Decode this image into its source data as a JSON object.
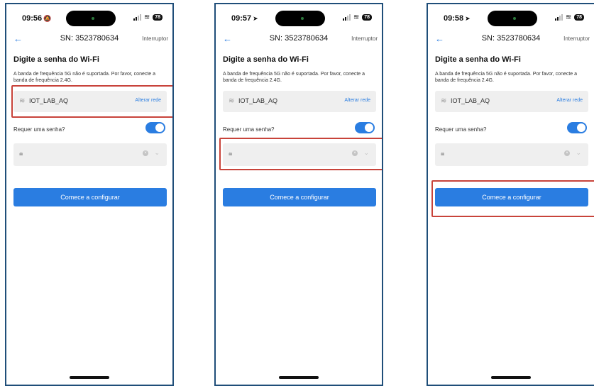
{
  "screens": [
    {
      "time": "09:56",
      "time_glyph": "🔕",
      "battery": "78",
      "serial": "SN: 3523780634",
      "nav_right": "Interruptor",
      "heading": "Digite a senha do Wi-Fi",
      "subtext": "A banda de frequência 5G não é suportada. Por favor, conecte a banda de frequência 2.4G.",
      "ssid": "IOT_LAB_AQ",
      "change_network": "Alterar rede",
      "password_required_label": "Requer uma senha?",
      "password_value": "",
      "start_button": "Comece a configurar",
      "highlighted": "network-row"
    },
    {
      "time": "09:57",
      "time_glyph": "➤",
      "battery": "78",
      "serial": "SN: 3523780634",
      "nav_right": "Interruptor",
      "heading": "Digite a senha do Wi-Fi",
      "subtext": "A banda de frequência 5G não é suportada. Por favor, conecte a banda de frequência 2.4G.",
      "ssid": "IOT_LAB_AQ",
      "change_network": "Alterar rede",
      "password_required_label": "Requer uma senha?",
      "password_value": "",
      "start_button": "Comece a configurar",
      "highlighted": "password-field"
    },
    {
      "time": "09:58",
      "time_glyph": "➤",
      "battery": "78",
      "serial": "SN: 3523780634",
      "nav_right": "Interruptor",
      "heading": "Digite a senha do Wi-Fi",
      "subtext": "A banda de frequência 5G não é suportada. Por favor, conecte a banda de frequência 2.4G.",
      "ssid": "IOT_LAB_AQ",
      "change_network": "Alterar rede",
      "password_required_label": "Requer uma senha?",
      "password_value": "",
      "start_button": "Comece a configurar",
      "highlighted": "start-button"
    }
  ],
  "colors": {
    "accent": "#2a7de1",
    "highlight": "#c8433a",
    "frame": "#1f4e79",
    "field_bg": "#efefef"
  }
}
